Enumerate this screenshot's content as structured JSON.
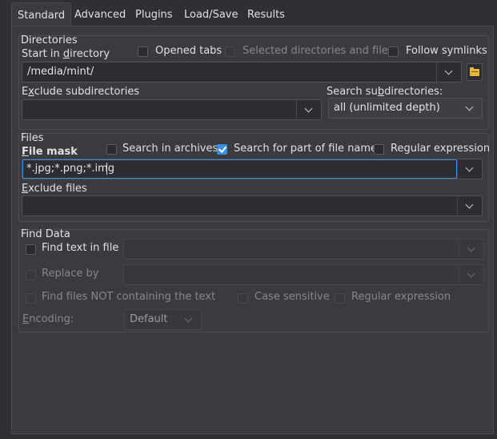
{
  "tabs": [
    {
      "label": "Standard",
      "active": true
    },
    {
      "label": "Advanced"
    },
    {
      "label": "Plugins"
    },
    {
      "label": "Load/Save"
    },
    {
      "label": "Results"
    }
  ],
  "directories": {
    "title": "Directories",
    "start_label": "Start in directory",
    "start_value": "/media/mint/",
    "opened_tabs": "Opened tabs",
    "selected_dirs": "Selected directories and files",
    "follow_symlinks": "Follow symlinks",
    "exclude_label": "Exclude subdirectories",
    "exclude_value": "",
    "search_sub_label": "Search subdirectories:",
    "search_sub_value": "all (unlimited depth)"
  },
  "files": {
    "title": "Files",
    "mask_label": "File mask",
    "mask_value": "*.jpg;*.png;*.img",
    "search_archives": "Search in archives",
    "search_part": "Search for part of file name",
    "search_part_checked": true,
    "regex": "Regular expression",
    "exclude_label": "Exclude files",
    "exclude_value": ""
  },
  "find": {
    "title": "Find Data",
    "find_text": "Find text in file",
    "replace_by": "Replace by",
    "not_containing": "Find files NOT containing the text",
    "case_sensitive": "Case sensitive",
    "regex": "Regular expression",
    "encoding_label": "Encoding:",
    "encoding_value": "Default"
  },
  "colors": {
    "accent": "#3d8ee0",
    "folder": "#e8b83a"
  }
}
